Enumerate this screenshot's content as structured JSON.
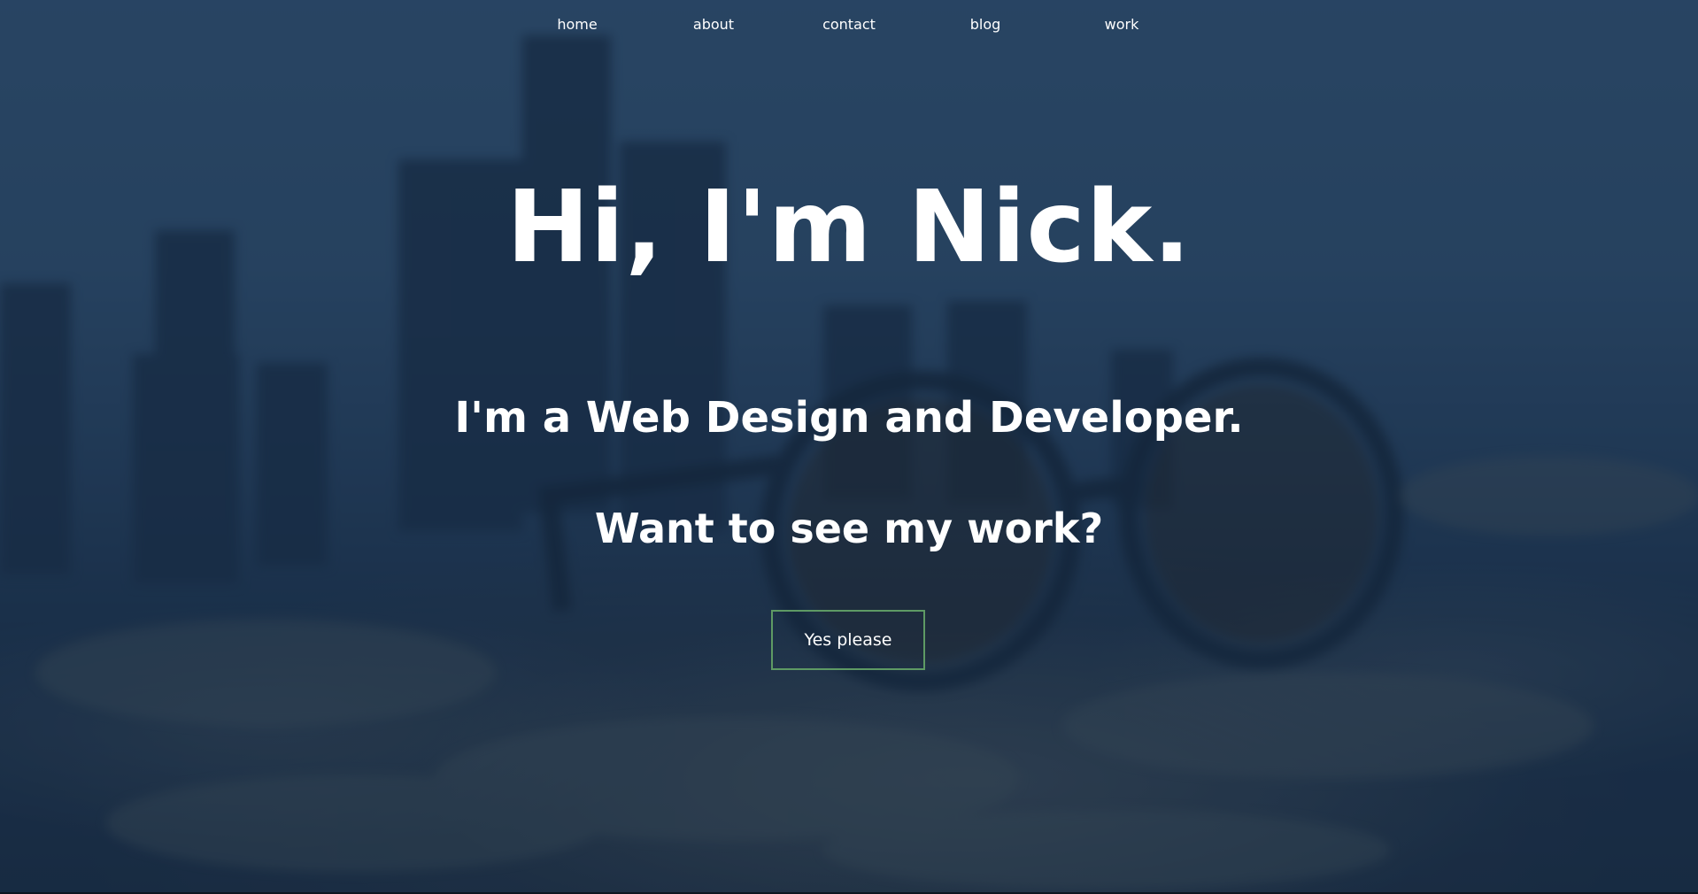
{
  "nav": {
    "items": [
      {
        "label": "home"
      },
      {
        "label": "about"
      },
      {
        "label": "contact"
      },
      {
        "label": "blog"
      },
      {
        "label": "work"
      }
    ]
  },
  "hero": {
    "title": "Hi, I'm Nick.",
    "subtitle": "I'm a Web Design and Developer.",
    "question": "Want to see my work?",
    "cta_label": "Yes please"
  },
  "colors": {
    "overlay": "#162e4a",
    "button_border": "#5e9a64",
    "text": "#ffffff"
  }
}
